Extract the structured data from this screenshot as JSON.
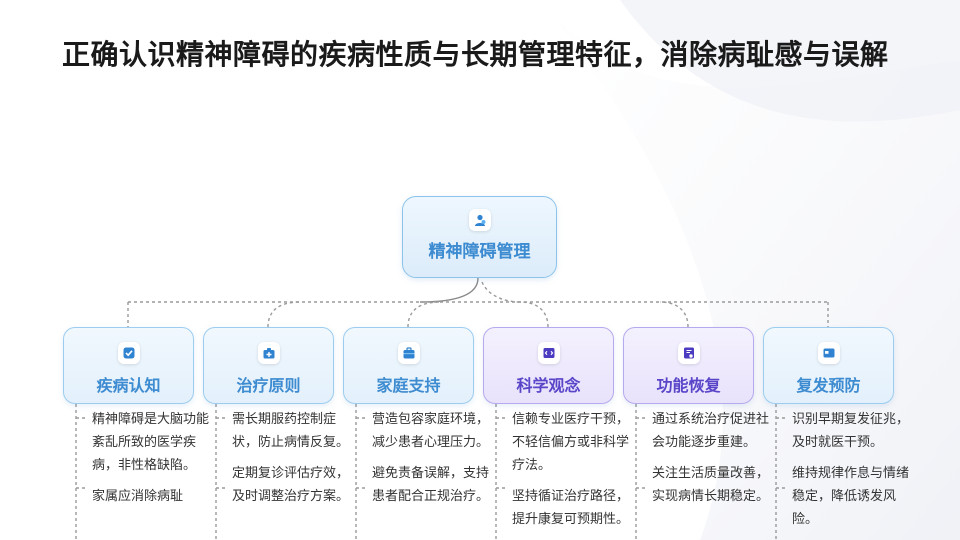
{
  "title": "正确认识精神障碍的疾病性质与长期管理特征，消除病耻感与误解",
  "colors": {
    "blue": "#3d8bd0",
    "purple": "#5a45c9",
    "connector": "#9a9a9a"
  },
  "root": {
    "label": "精神障碍管理",
    "icon": "person-heart-icon"
  },
  "nodes": [
    {
      "label": "疾病认知",
      "icon": "check-square-icon",
      "style": "blue",
      "desc": [
        "精神障碍是大脑功能紊乱所致的医学疾病，非性格缺陷。",
        "家属应消除病耻"
      ]
    },
    {
      "label": "治疗原则",
      "icon": "medicine-kit-icon",
      "style": "blue",
      "desc": [
        "需长期服药控制症状，防止病情反复。",
        "定期复诊评估疗效，及时调整治疗方案。"
      ]
    },
    {
      "label": "家庭支持",
      "icon": "briefcase-icon",
      "style": "blue",
      "desc": [
        "营造包容家庭环境，减少患者心理压力。",
        "避免责备误解，支持患者配合正规治疗。"
      ]
    },
    {
      "label": "科学观念",
      "icon": "code-window-icon",
      "style": "purple",
      "desc": [
        "信赖专业医疗干预，不轻信偏方或非科学疗法。",
        "坚持循证治疗路径，提升康复可预期性。"
      ]
    },
    {
      "label": "功能恢复",
      "icon": "document-settings-icon",
      "style": "purple",
      "desc": [
        "通过系统治疗促进社会功能逐步重建。",
        "关注生活质量改善，实现病情长期稳定。"
      ]
    },
    {
      "label": "复发预防",
      "icon": "window-icon",
      "style": "blue",
      "desc": [
        "识别早期复发征兆，及时就医干预。",
        "维持规律作息与情绪稳定，降低诱发风险。"
      ]
    }
  ]
}
